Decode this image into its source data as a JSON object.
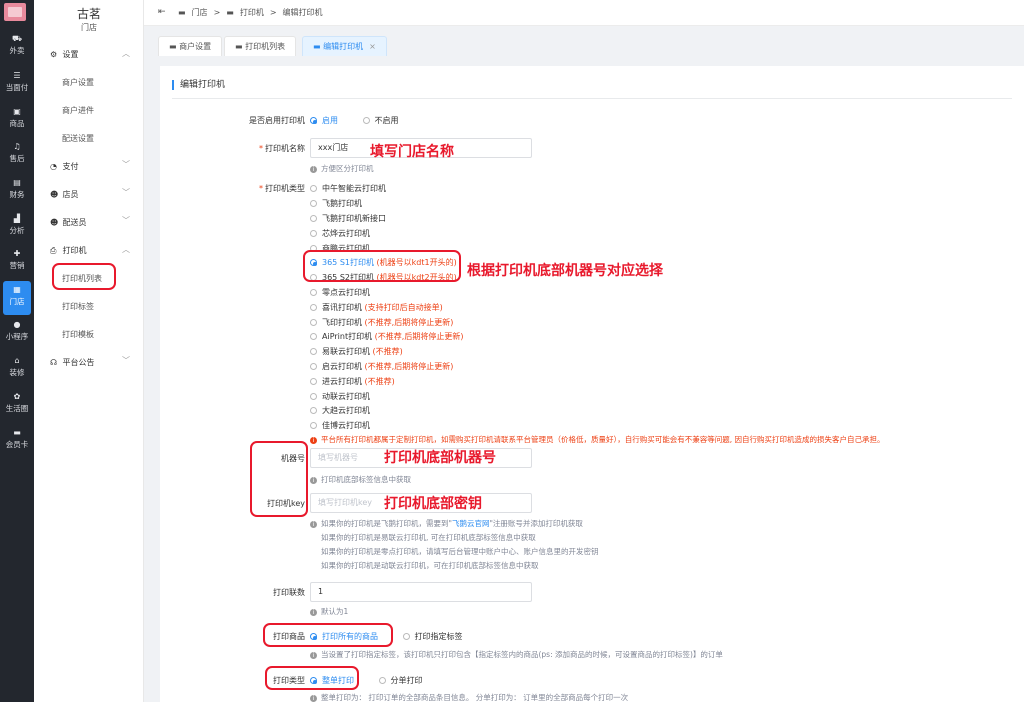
{
  "rail": [
    {
      "label": "外卖",
      "icon": "bike-icon"
    },
    {
      "label": "当面付",
      "icon": "list-icon"
    },
    {
      "label": "商品",
      "icon": "goods-icon"
    },
    {
      "label": "售后",
      "icon": "headset-icon"
    },
    {
      "label": "财务",
      "icon": "wallet-icon"
    },
    {
      "label": "分析",
      "icon": "bar-chart-icon"
    },
    {
      "label": "营销",
      "icon": "gift-icon"
    },
    {
      "label": "门店",
      "icon": "store-icon",
      "active": true
    },
    {
      "label": "小程序",
      "icon": "wechat-icon"
    },
    {
      "label": "装修",
      "icon": "brush-icon"
    },
    {
      "label": "生活圈",
      "icon": "circle-icon"
    },
    {
      "label": "会员卡",
      "icon": "card-icon"
    }
  ],
  "shop": {
    "name": "古茗",
    "sub": "门店"
  },
  "menu": {
    "settings": "设置",
    "merchant_settings": "商户设置",
    "merchant_progress": "商户进件",
    "delivery_settings": "配送设置",
    "payment": "支付",
    "clerk": "店员",
    "deliverer": "配送员",
    "printer": "打印机",
    "printer_list": "打印机列表",
    "print_label": "打印标签",
    "print_template": "打印模板",
    "notice": "平台公告"
  },
  "breadcrumb": {
    "c1": "门店",
    "sep": ">",
    "c2": "打印机",
    "c3": "编辑打印机"
  },
  "tabs": {
    "t1": "商户设置",
    "t2": "打印机列表",
    "t3": "编辑打印机"
  },
  "form": {
    "title": "编辑打印机",
    "enable_label": "是否启用打印机",
    "enable_on": "启用",
    "enable_off": "不启用",
    "name_label": "打印机名称",
    "name_value": "xxx门店",
    "name_tip": "方便区分打印机",
    "type_label": "打印机类型",
    "types": {
      "t1": "中午智能云打印机",
      "t2": "飞鹅打印机",
      "t3": "飞鹅打印机新接口",
      "t4": "芯烨云打印机",
      "t5": "商鹏云打印机",
      "t6": "365 S1打印机",
      "t6n": "(机器号以kdt1开头的)",
      "t7": "365 S2打印机",
      "t7n": "(机器号以kdt2开头的)",
      "t8": "零点云打印机",
      "t9": "喜讯打印机",
      "t9n": "(支持打印后自动接单)",
      "t10": "飞印打印机",
      "t10n": "(不推荐,后期将停止更新)",
      "t11": "AiPrint打印机",
      "t11n": "(不推荐,后期将停止更新)",
      "t12": "易联云打印机",
      "t12n": "(不推荐)",
      "t13": "启云打印机",
      "t13n": "(不推荐,后期将停止更新)",
      "t14": "进云打印机",
      "t14n": "(不推荐)",
      "t15": "动联云打印机",
      "t16": "大趋云打印机",
      "t17": "佳博云打印机"
    },
    "type_warning": "平台所有打印机都属于定制打印机，如需购买打印机请联系平台管理员（价格低，质量好），自行购买可能会有不兼容等问题, 因自行购买打印机造成的损失客户自己承担。",
    "machine_label": "机器号",
    "machine_placeholder": "填写机器号",
    "machine_tip": "打印机底部标签信息中获取",
    "key_label": "打印机key",
    "key_placeholder": "填写打印机key",
    "key_tip1a": "如果你的打印机是飞鹅打印机，需要到\"",
    "key_tip1_link": "飞鹅云官网",
    "key_tip1b": "\"注册账号并添加打印机获取",
    "key_tip2": "如果你的打印机是易联云打印机, 可在打印机底部标签信息中获取",
    "key_tip3": "如果你的打印机是零点打印机，请填写后台管理中账户中心、账户信息里的开发密钥",
    "key_tip4": "如果你的打印机是动联云打印机，可在打印机底部标签信息中获取",
    "copies_label": "打印联数",
    "copies_value": "1",
    "copies_tip": "默认为1",
    "goods_label": "打印商品",
    "goods_all": "打印所有的商品",
    "goods_tag": "打印指定标签",
    "goods_tip": "当设置了打印指定标签，该打印机只打印包含【指定标签内的商品(ps: 添加商品的时候，可设置商品的打印标签)】的订单",
    "mode_label": "打印类型",
    "mode_whole": "整单打印",
    "mode_split": "分单打印",
    "mode_tip": "整单打印为： 打印订单的全部商品条目信息。 分单打印为： 订单里的全部商品每个打印一次"
  },
  "annotations": {
    "a1": "填写门店名称",
    "a2": "根据打印机底部机器号对应选择",
    "a3": "打印机底部机器号",
    "a4": "打印机底部密钥"
  }
}
